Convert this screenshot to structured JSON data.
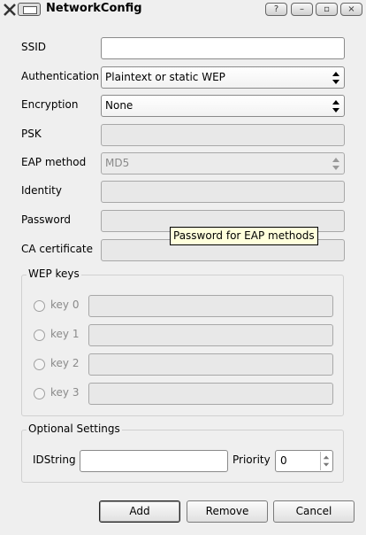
{
  "window": {
    "title": "NetworkConfig",
    "buttons": [
      "?",
      "–",
      "▫",
      "×"
    ]
  },
  "form": {
    "ssid_label": "SSID",
    "ssid_value": "",
    "auth_label": "Authentication",
    "auth_value": "Plaintext or static WEP",
    "enc_label": "Encryption",
    "enc_value": "None",
    "psk_label": "PSK",
    "eap_label": "EAP method",
    "eap_value": "MD5",
    "identity_label": "Identity",
    "password_label": "Password",
    "ca_label": "CA certificate"
  },
  "tooltip": "Password for EAP methods",
  "wep": {
    "title": "WEP keys",
    "keys": [
      "key 0",
      "key 1",
      "key 2",
      "key 3"
    ]
  },
  "optional": {
    "title": "Optional Settings",
    "idstring_label": "IDString",
    "idstring_value": "",
    "priority_label": "Priority",
    "priority_value": "0"
  },
  "actions": {
    "add": "Add",
    "remove": "Remove",
    "cancel": "Cancel"
  }
}
